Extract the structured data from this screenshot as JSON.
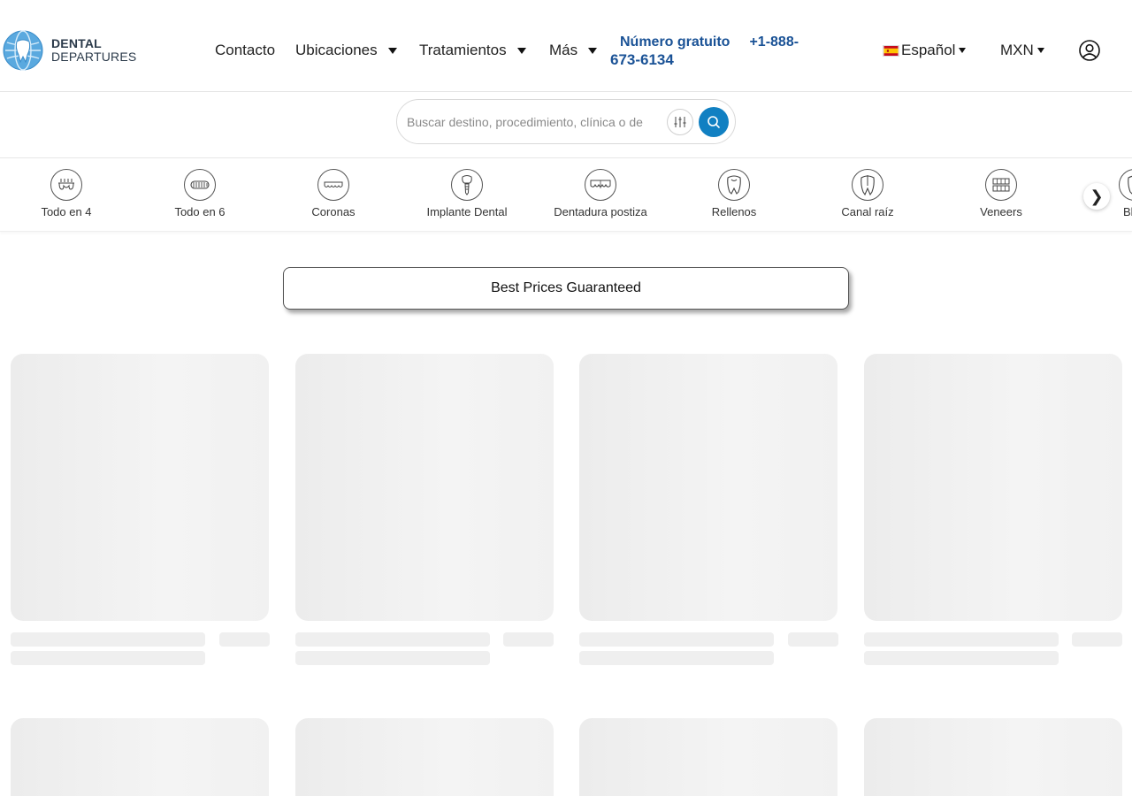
{
  "brand": {
    "line1": "DENTAL",
    "line2": "DEPARTURES"
  },
  "nav": {
    "contact": "Contacto",
    "locations": "Ubicaciones",
    "treatments": "Tratamientos",
    "more": "Más"
  },
  "phone": {
    "label": "Número gratuito",
    "number_part1": "+1-888-",
    "number_part2": "673-6134"
  },
  "language": {
    "flag_icon": "spain-flag-icon",
    "label": "Español"
  },
  "currency": {
    "label": "MXN"
  },
  "search": {
    "placeholder": "Buscar destino, procedimiento, clínica o de"
  },
  "categories": [
    {
      "label": "Todo en 4",
      "icon": "all-on-4-icon"
    },
    {
      "label": "Todo en 6",
      "icon": "all-on-6-icon"
    },
    {
      "label": "Coronas",
      "icon": "crowns-icon"
    },
    {
      "label": "Implante Dental",
      "icon": "dental-implant-icon"
    },
    {
      "label": "Dentadura postiza",
      "icon": "dentures-icon"
    },
    {
      "label": "Rellenos",
      "icon": "fillings-icon"
    },
    {
      "label": "Canal raíz",
      "icon": "root-canal-icon"
    },
    {
      "label": "Veneers",
      "icon": "veneers-icon"
    },
    {
      "label": "Blan",
      "icon": "whitening-icon"
    }
  ],
  "banner": {
    "text": "Best Prices Guaranteed"
  },
  "colors": {
    "accent": "#1180c2",
    "phone": "#1a5296",
    "skeleton": "#efefef"
  }
}
